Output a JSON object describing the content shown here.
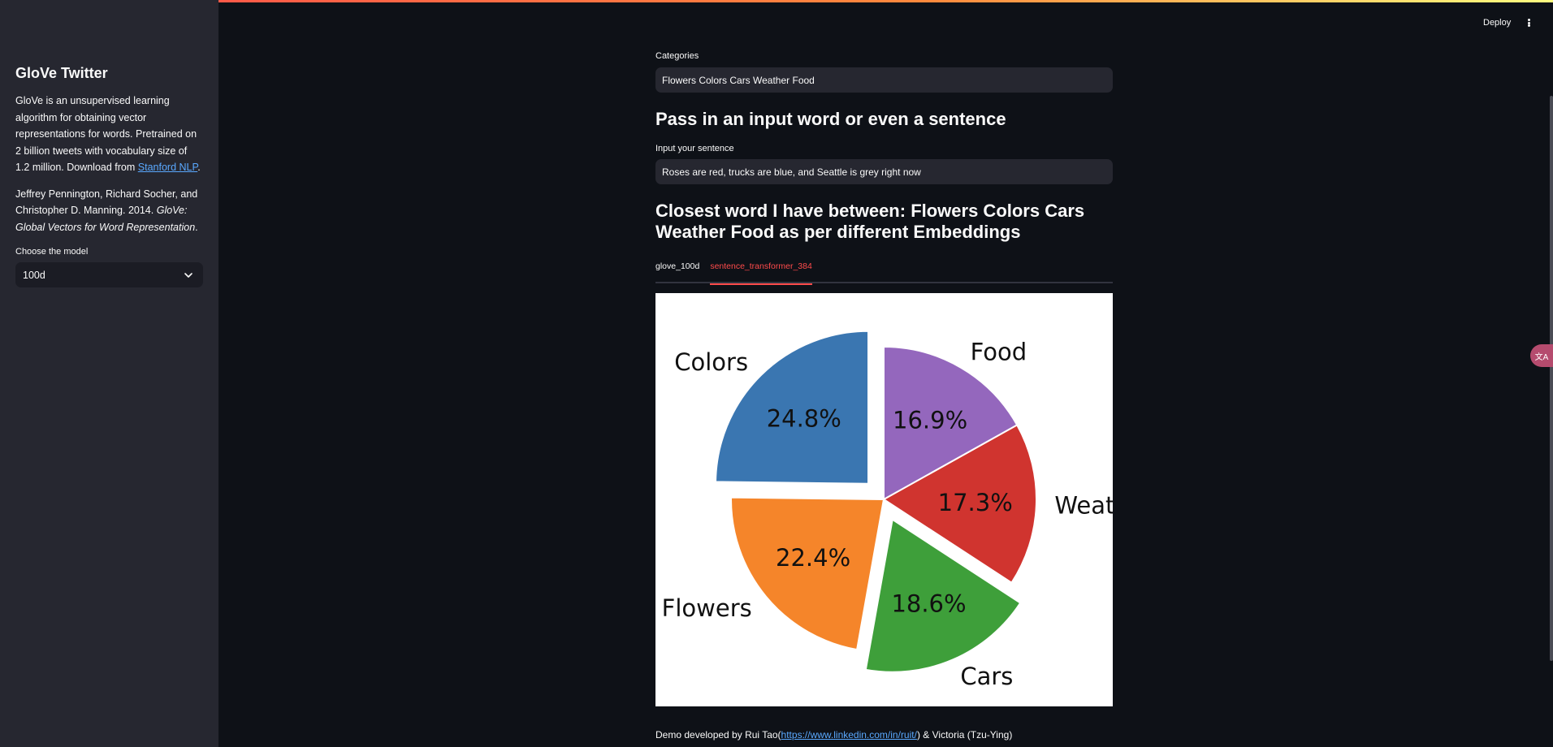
{
  "sidebar": {
    "title": "GloVe Twitter",
    "description_prefix": "GloVe is an unsupervised learning algorithm for obtaining vector representations for words. Pretrained on 2 billion tweets with vocabulary size of 1.2 million. Download from ",
    "description_link": "Stanford NLP",
    "description_suffix": ".",
    "citation_prefix": "Jeffrey Pennington, Richard Socher, and Christopher D. Manning. 2014. ",
    "citation_title": "GloVe: Global Vectors for Word Representation",
    "citation_suffix": ".",
    "model_label": "Choose the model",
    "model_value": "100d"
  },
  "header": {
    "deploy_label": "Deploy"
  },
  "main": {
    "categories_label": "Categories",
    "categories_value": "Flowers Colors Cars Weather Food",
    "input_heading": "Pass in an input word or even a sentence",
    "sentence_label": "Input your sentence",
    "sentence_value": "Roses are red, trucks are blue, and Seattle is grey right now",
    "result_heading": "Closest word I have between: Flowers Colors Cars Weather Food as per different Embeddings",
    "tabs": [
      {
        "label": "glove_100d"
      },
      {
        "label": "sentence_transformer_384"
      }
    ]
  },
  "footer": {
    "prefix": "Demo developed by Rui Tao(",
    "link": "https://www.linkedin.com/in/ruit/",
    "suffix": ") & Victoria (Tzu-Ying)"
  },
  "translate_badge": "文A",
  "chart_data": {
    "type": "pie",
    "categories": [
      "Colors",
      "Flowers",
      "Cars",
      "Weather",
      "Food"
    ],
    "values": [
      24.8,
      22.4,
      18.6,
      17.3,
      16.9
    ],
    "labels": [
      "24.8%",
      "22.4%",
      "18.6%",
      "17.3%",
      "16.9%"
    ],
    "colors": [
      "#3a76b1",
      "#f5852a",
      "#3e9f3a",
      "#d0342f",
      "#9467bd"
    ],
    "exploded": [
      "Colors",
      "Cars"
    ],
    "start_angle_deg": 90,
    "title": ""
  }
}
